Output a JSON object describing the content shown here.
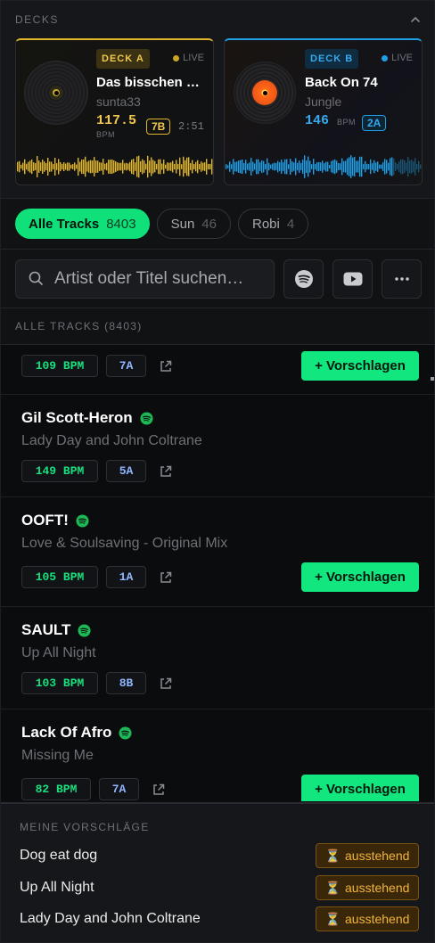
{
  "colors": {
    "accent_green": "#12e67e",
    "deck_a": "#e0b62a",
    "deck_b": "#1e9fe6",
    "pending": "#f2b53a"
  },
  "decks_header": {
    "title": "DECKS",
    "collapse_icon": "chevron-up-icon"
  },
  "deck_a": {
    "badge": "DECK A",
    "live": "LIVE",
    "title": "Das bisschen …",
    "artist": "sunta33",
    "bpm": "117.5",
    "bpm_unit": "BPM",
    "key": "7B",
    "time": "2:51"
  },
  "deck_b": {
    "badge": "DECK B",
    "live": "LIVE",
    "title": "Back On 74",
    "artist": "Jungle",
    "bpm": "146",
    "bpm_unit": "BPM",
    "key": "2A"
  },
  "playlists": [
    {
      "label": "Alle Tracks",
      "count": "8403",
      "active": true
    },
    {
      "label": "Sun",
      "count": "46",
      "active": false
    },
    {
      "label": "Robi",
      "count": "4",
      "active": false
    }
  ],
  "search": {
    "placeholder": "Artist oder Titel suchen…",
    "icons": [
      "search-icon",
      "spotify-icon",
      "youtube-icon",
      "more-icon"
    ]
  },
  "list_header": "ALLE TRACKS (8403)",
  "tracks": [
    {
      "artist": "",
      "song": "",
      "bpm": "109 BPM",
      "key": "7A",
      "suggest": "+ Vorschlagen"
    },
    {
      "artist": "Gil Scott-Heron",
      "song": "Lady Day and John Coltrane",
      "bpm": "149 BPM",
      "key": "5A",
      "suggest": ""
    },
    {
      "artist": "OOFT!",
      "song": "Love & Soulsaving - Original Mix",
      "bpm": "105 BPM",
      "key": "1A",
      "suggest": "+ Vorschlagen"
    },
    {
      "artist": "SAULT",
      "song": "Up All Night",
      "bpm": "103 BPM",
      "key": "8B",
      "suggest": ""
    },
    {
      "artist": "Lack Of Afro",
      "song": "Missing Me",
      "bpm": "82 BPM",
      "key": "7A",
      "suggest": "+ Vorschlagen"
    }
  ],
  "my_suggestions": {
    "title": "MEINE VORSCHLÄGE",
    "items": [
      {
        "name": "Dog eat dog",
        "status": "ausstehend",
        "status_icon": "⏳"
      },
      {
        "name": "Up All Night",
        "status": "ausstehend",
        "status_icon": "⏳"
      },
      {
        "name": "Lady Day and John Coltrane",
        "status": "ausstehend",
        "status_icon": "⏳"
      }
    ]
  }
}
